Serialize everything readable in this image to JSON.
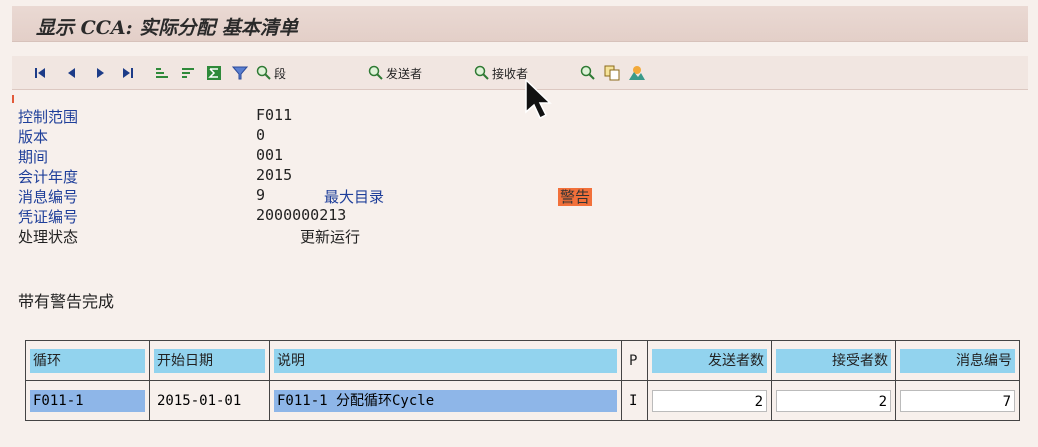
{
  "window": {
    "title": "显示 CCA: 实际分配 基本清单"
  },
  "toolbar": {
    "first": "⏮",
    "prev": "◀",
    "next": "▶",
    "last": "⏭",
    "btn_segment": "段",
    "btn_sender": "发送者",
    "btn_receiver": "接收者"
  },
  "info": {
    "controlling_area": {
      "label": "控制范围",
      "value": "F011"
    },
    "version": {
      "label": "版本",
      "value": "0"
    },
    "period": {
      "label": "期间",
      "value": "001"
    },
    "fiscal_year": {
      "label": "会计年度",
      "value": "2015"
    },
    "message_number": {
      "label": "消息编号",
      "value": "9",
      "link": "最大目录",
      "badge": "警告"
    },
    "document_number": {
      "label": "凭证编号",
      "value": "2000000213"
    },
    "processing_status": {
      "label": "处理状态",
      "value": "更新运行"
    }
  },
  "status_message": "带有警告完成",
  "table": {
    "headers": [
      "循环",
      "开始日期",
      "说明",
      "P",
      "发送者数",
      "接受者数",
      "消息编号"
    ],
    "rows": [
      [
        "F011-1",
        "2015-01-01",
        "F011-1 分配循环Cycle",
        "I",
        "2",
        "2",
        "7"
      ]
    ]
  },
  "colors": {
    "header_cell": "#92d3ee",
    "selected_cell": "#8eb6e8",
    "warning_badge": "#f2703a",
    "label_blue": "#1f3f9a"
  }
}
